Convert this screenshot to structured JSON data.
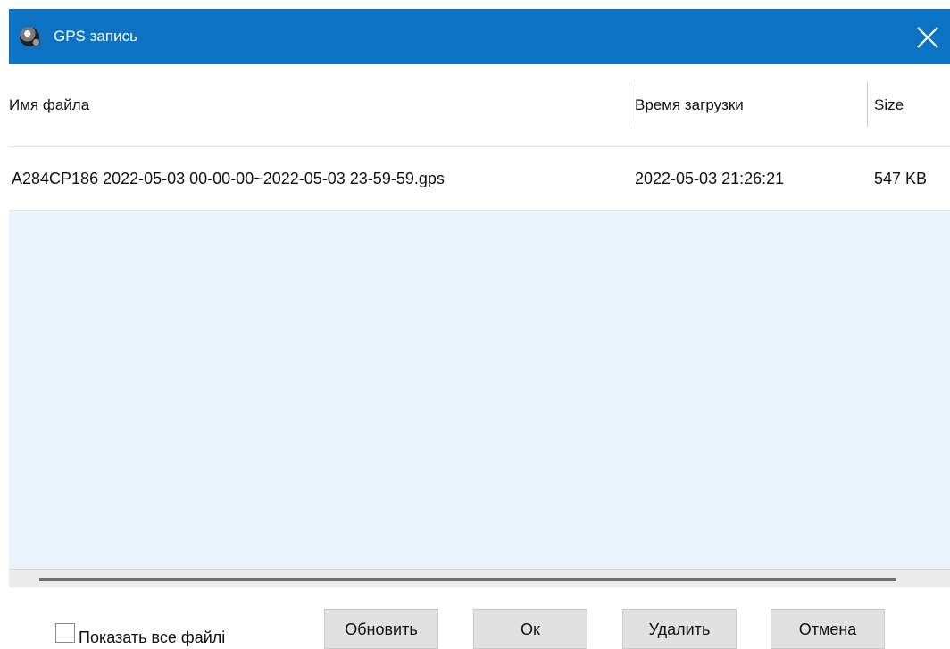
{
  "window": {
    "title": "GPS запись",
    "icon": "app-logo-icon",
    "close_icon": "close-icon",
    "title_bar_color": "#0b72c4"
  },
  "table": {
    "columns": [
      {
        "label": "Имя файла"
      },
      {
        "label": "Время загрузки"
      },
      {
        "label": "Size"
      }
    ],
    "rows": [
      {
        "file_name": "A284CP186 2022-05-03 00-00-00~2022-05-03 23-59-59.gps",
        "upload_time": "2022-05-03 21:26:21",
        "size": "547 KB"
      }
    ],
    "empty_area_color": "#eaf3fb"
  },
  "footer": {
    "show_all_label": "Показать все файлі",
    "show_all_checked": false,
    "buttons": {
      "refresh": "Обновить",
      "ok": "Ок",
      "delete": "Удалить",
      "cancel": "Отмена"
    }
  }
}
